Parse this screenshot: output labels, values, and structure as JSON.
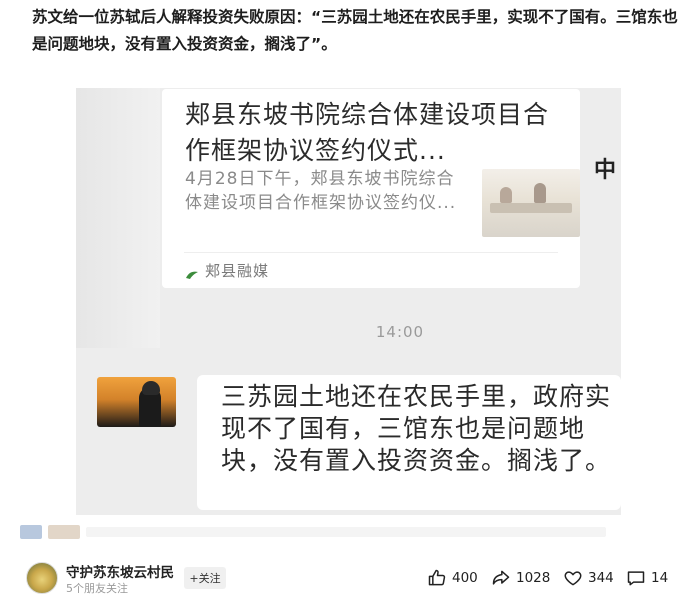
{
  "post": {
    "text": "苏文给一位苏轼后人解释投资失败原因：“三苏园土地还在农民手里，实现不了国有。三馆东也是问题地块，没有置入投资资金，搁浅了”。"
  },
  "screenshot": {
    "link_card": {
      "title": "郏县东坡书院综合体建设项目合作框架协议签约仪式...",
      "description": "4月28日下午，郏县东坡书院综合体建设项目合作框架协议签约仪...",
      "source": "郏县融媒"
    },
    "edge_char": "中",
    "time": "14:00",
    "message": "三苏园土地还在农民手里，政府实现不了国有，三馆东也是问题地块，没有置入投资资金。搁浅了。"
  },
  "footer": {
    "author_name": "守护苏东坡云村民",
    "author_sub": "5个朋友关注",
    "follow_label": "+关注",
    "likes": "400",
    "shares": "1028",
    "favorites": "344",
    "comments": "14"
  },
  "icons": {
    "like": "thumbs-up-icon",
    "share": "share-arrow-icon",
    "favorite": "heart-icon",
    "comment": "comment-icon",
    "source": "source-logo-icon"
  }
}
